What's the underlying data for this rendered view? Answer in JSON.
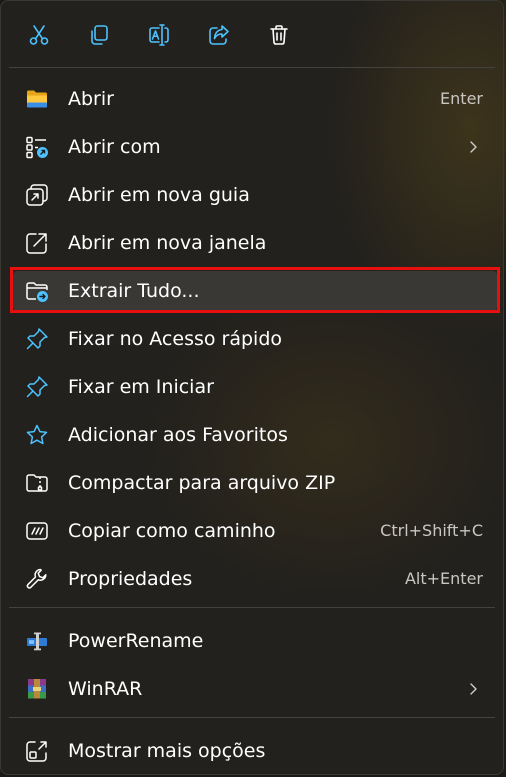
{
  "toolbar": {
    "buttons": [
      {
        "name": "cut",
        "icon": "scissors-icon"
      },
      {
        "name": "copy",
        "icon": "copy-icon"
      },
      {
        "name": "rename",
        "icon": "rename-icon"
      },
      {
        "name": "share",
        "icon": "share-icon"
      },
      {
        "name": "delete",
        "icon": "trash-icon"
      }
    ]
  },
  "items": [
    {
      "label": "Abrir",
      "shortcut": "Enter",
      "icon": "folder-icon"
    },
    {
      "label": "Abrir com",
      "submenu": true,
      "icon": "open-with-icon"
    },
    {
      "label": "Abrir em nova guia",
      "icon": "new-tab-icon"
    },
    {
      "label": "Abrir em nova janela",
      "icon": "new-window-icon"
    },
    {
      "label": "Extrair Tudo...",
      "icon": "extract-folder-icon",
      "selected": true
    },
    {
      "label": "Fixar no Acesso rápido",
      "icon": "pin-icon"
    },
    {
      "label": "Fixar em Iniciar",
      "icon": "pin-icon"
    },
    {
      "label": "Adicionar aos Favoritos",
      "icon": "star-icon"
    },
    {
      "label": "Compactar para arquivo ZIP",
      "icon": "zip-icon"
    },
    {
      "label": "Copiar como caminho",
      "shortcut": "Ctrl+Shift+C",
      "icon": "copy-path-icon"
    },
    {
      "label": "Propriedades",
      "shortcut": "Alt+Enter",
      "icon": "wrench-icon"
    },
    {
      "label": "PowerRename",
      "icon": "powerrename-icon"
    },
    {
      "label": "WinRAR",
      "submenu": true,
      "icon": "winrar-icon"
    },
    {
      "label": "Mostrar mais opções",
      "icon": "more-options-icon"
    }
  ],
  "colors": {
    "accent": "#4cc2ff",
    "highlight_border": "#e8100f",
    "menu_bg": "#24221e"
  }
}
